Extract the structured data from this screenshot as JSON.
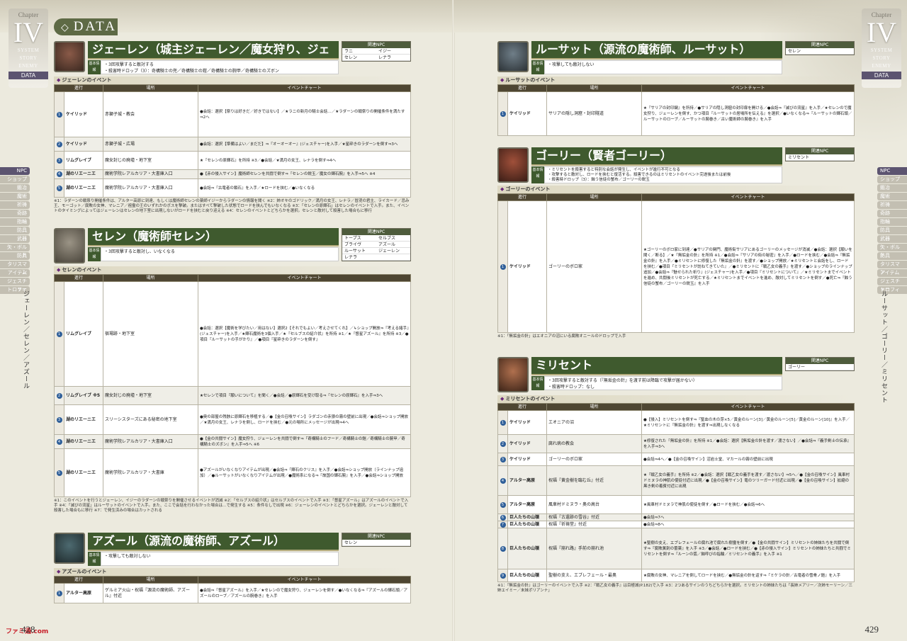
{
  "header": {
    "data_label": "DATA"
  },
  "chapter": {
    "word": "Chapter",
    "numeral": "IV",
    "menu": [
      "SYSTEM",
      "STORY",
      "ENEMY"
    ],
    "active": "DATA"
  },
  "side_tabs": [
    "NPC",
    "ショップ",
    "鍛冶",
    "魔術",
    "祈祷",
    "奇跡",
    "指輪",
    "防具",
    "武器",
    "矢・ボルト",
    "防具",
    "タリスマン",
    "アイテム",
    "ジェスチャー",
    "トロフィー"
  ],
  "left_vertical": "ジェーレン／セレン／アズール",
  "right_vertical": "ルーサット／ゴーリー／ミリセント",
  "table_headers": {
    "no": "進行",
    "place": "場所",
    "chart": "イベントチャート"
  },
  "npc_header": "関連NPC",
  "info_tag": "基本情報",
  "characters": {
    "jerren": {
      "name": "ジェーレン（城主ジェーレン／魔女狩り、ジェーレン）",
      "info": [
        "・3回攻撃すると敵対する",
        "・殺害時ドロップ（3）：奇構騎士の兜／奇構騎士の鎧／奇構騎士の腕甲／奇構騎士のズボン"
      ],
      "npcs": [
        "ラニ",
        "イジー",
        "セレン",
        "レナラ"
      ],
      "events_title": "ジェーレンのイベント",
      "rows": [
        {
          "no": "1",
          "who": "ケイリッド",
          "place": "赤獅子城・教会",
          "chart": "●会話：選択【祭りは好きだ／好きではない】／★ラニの新月の騎士会話…／★ラダーンの戦祭りの開催条件を満たす⇒2へ"
        },
        {
          "no": "2",
          "who": "ケイリッド",
          "place": "赤獅子城・広場",
          "chart": "●会話：選択【準備はよい／まだだ】⇒『オーオーオー』(ジェスチャー)を入手／★星砕きのラダーンを倒す⇒3へ"
        },
        {
          "no": "3",
          "who": "リムグレイブ",
          "place": "魔女封じの廃墟・地下室",
          "chart": "★『セレンの原輝石』を所持 ※3／●会話／★満月の女王、レナラを倒す⇒4へ"
        },
        {
          "no": "4",
          "who": "湖のリエーニエ",
          "place": "魔術学院レアルカリア・大書庫入口",
          "chart": "●【赤の侵入サイン】魔術師セレンを共闘で倒す⇒『セレンの鋭玉／魔女の輝石腕』を入手⇒5へ ※4"
        },
        {
          "no": "5",
          "who": "湖のリエーニエ",
          "place": "魔術学院レアルカリア・大書庫入口",
          "chart": "●会話⇒『古竜者の鎖石』を入手／★ロードを挟む／●いなくなる"
        }
      ],
      "note": "※1：ラダーンの戦祭り開催条件は、アルター高原に到達、もしくは魔術師セレンの薬師イジーからラダーンの情報を聞く ※2：姉オキのゴドリック／満月の女王、レナラ／冒涜の君主、ライカード／忌み王、モーゴット／腐敗の女神、マレニア／祖霊の王のいずれかのボスを撃破。またはすべて撃破した状態でロードを挟んでもいなくなる ※3：「セレンの原輝石」はセレンのイベントで入手。また、イベントのタイミングによってはジェーレンはセレンの地下室に出現しないがロードを挟むと戻り迎える ※4：セレンのイベントとどちらかを選択。セレンと敵対して殺害した場合もに移行"
    },
    "sellen": {
      "name": "セレン（魔術師セレン）",
      "info": [
        "・3回攻撃すると敵対し、いなくなる"
      ],
      "npcs": [
        "トープス",
        "セルブス",
        "ブライヴ",
        "アズール",
        "ルーサット",
        "ジェーレン",
        "レナラ",
        ""
      ],
      "events_title": "セレンのイベント",
      "rows": [
        {
          "no": "1",
          "who": "リムグレイブ",
          "place": "宿場跡・地下室",
          "chart": "●会話：選択【魔術を学びたい／用はない】選択2【それでもよい／考えさせてくれ】／↳ショップ開放⇒『考える諸手』(ジェスチャー)を入手／★輝石魔術を3個入手／★『セルブスの紹介状』を所持 ※1／★『督星アズール』を所持 ※3／●項目『ルーサットの手がかり』／●項目『星砕きのラダーンを倒す』"
        },
        {
          "no": "2",
          "who": "リムグレイブ ※5",
          "place": "魔女封じの廃墟・地下室",
          "chart": "★セレンで項目『願いについて』を聞く／●会話／●原輝石を受け取る⇒『セレンの原輝石』を入手⇒3へ"
        },
        {
          "no": "3",
          "who": "湖のリエーニエ",
          "place": "スリーシスターズにある秘密の地下室",
          "chart": "●奥の部屋の残骸に原輝石を移植する／●【金の召喚サイン】ラダゴンの赤狼の霧の壁前に出現／●会話⇒ショップ開放／★満月の女王、レナラを倒し、ロードを挟む／●元の場所にメッセージが出現⇒4へ"
        },
        {
          "no": "4",
          "who": "湖のリエーニエ",
          "place": "魔術学院レアルカリア・大書庫入口",
          "chart": "●【金の共闘サイン】魔女狩り、ジェーレンを共闘で倒す⇒『奇構騎士のフード／奇構騎士の鎧／奇構騎士の腕甲／奇構騎士のズボン』を入手⇒5へ ※6"
        },
        {
          "no": "5",
          "who": "湖のリエーニエ",
          "place": "魔術学院レアルカリア・大書庫",
          "chart": "●アズールがいなくなりアイテムが出現／●会話⇒『輝石のクリス』を入手／●会話⇒ショップ開放（ラインナップ追加）／●ルーサットがいなくなりアイテムが出現／●魔術系になる⇒『故国の輝石腕』を入手／●会話⇒ショップ開放"
        }
      ],
      "note": "※1：このイベントを行うとジェーレン、イジーのラダーンの戦祭りを開催させるイベントが消滅 ※2：「セルブスの紹介状」はセルブスのイベントで入手 ※3：「督星アズール」はアズールのイベントで入手 ※4：「滅びの流星」はルーサットのイベントで入手。また、ここで会話を行わなかった場合は…で発生する ※5：条件なしで出現 ※6：ジェーレンのイベントとどちらかを選択。ジェーレンと敵対して殺害した場合もに移行 ※7：で発生済みの場合はカットされる"
    },
    "azur": {
      "name": "アズール（源流の魔術師、アズール）",
      "info": [
        "・攻撃しても敵対しない"
      ],
      "npcs": [
        "セレン",
        ""
      ],
      "events_title": "アズールのイベント",
      "rows": [
        {
          "no": "1",
          "who": "アルター高原",
          "place": "ゲルミア火山・祝福『源流の魔術師、アズール』付近",
          "chart": "●会話⇒『督星アズール』を入手／★セレンので魔女狩り、ジェーレンを倒す／●いなくなる⇒『アズールの輝石頭／アズールのローブ／アズールの腕巻き』を入手"
        }
      ]
    },
    "rusat": {
      "name": "ルーサット（源流の魔術師、ルーサット）",
      "info": [
        "・攻撃しても敵対しない"
      ],
      "npcs": [
        "セレン",
        ""
      ],
      "events_title": "ルーサットのイベント",
      "rows": [
        {
          "no": "1",
          "who": "ケイリッド",
          "place": "サリアの隠し洞窟・封印隧道",
          "chart": "★『サリアの封印鍵』を所持／●サリアの隠し洞窟の封印扉を開ける／●会話⇒『滅びの流星』を入手／★セレンので魔女狩り、ジェーレンを倒す、かつ項目『ルーサットの居場所を伝える』を選択／●いなくなる⇒『ルーサットの輝石頭／ルーサットのローブ／ルーサットの腕巻き／古い魔術師の腕巻き』を入手"
        }
      ]
    },
    "gowry": {
      "name": "ゴーリー（賢者ゴーリー）",
      "info": [
        "・ミリセントを殺害すると特別な会話が発生し、イベントが進行不可となる",
        "・攻撃すると敵対し、ロードを挟むと復活する。殺害できるのはミリセントのイベント完遂後または前後",
        "・殺害時ドロップ（3）：蝕う信徒の蟹布／ゴーリーの鋭玉"
      ],
      "npcs": [
        "ミリセント",
        ""
      ],
      "events_title": "ゴーリーのイベント",
      "rows": [
        {
          "no": "1",
          "who": "ケイリッド",
          "place": "ゴーリーのボロ家",
          "chart": "★ゴーリーのボロ家に到達／●サリアの関門、魔術街サリアにあるゴーリーのメッセージが消滅／●会話：選択【願いを聞く／断る】／★『無垢金の針』を所持 ※1／●会話⇒『サリアの街の秘密』を入手／●ロードを挟む／●会話⇒『無垢金の針』を入手／●ミリセントに修復した『無垢金の針』を渡す／●ショップ開放／★ミリセントと会話をし、ロードを挟む／●項目『ミリセントが訪ねてきていた』／●ミリセントに『戦乙女の義手』を渡す／●ショップのラインナップ追加／●会話⇒『魅せられた祈り』(ジェスチャー)を入手／●項目『ミリセントについて』／★ミリセントまでイベントを進め、共闘後ミリセントが死亡する／★ミリセントまでイベントを進め、敵対してミリセントを倒す／●死亡⇒『蝕う信徒の蟹布／ゴーリーの鋭玉』を入手"
        }
      ],
      "note": "※1：「無垢金の針」はエオニアの沼にいる腐敗オニールのドロップで入手"
    },
    "millicent": {
      "name": "ミリセント",
      "info": [
        "・3回攻撃すると敵対する（『無垢金の針』を渡す前は降臨で攻撃が届かない）",
        "・殺害時ドロップ：なし"
      ],
      "npcs": [
        "ゴーリー",
        ""
      ],
      "events_title": "ミリセントのイベント",
      "rows": [
        {
          "no": "1",
          "who": "ケイリッド",
          "place": "エオニアの沼",
          "chart": "●【侵入】ミリセントを倒す⇒『聖血の木の芽×5／黄金のルーン[3]／黄金のルーン[5]／黄金のルーン[10]』を入手／★ミリセントに『無垢金の針』を渡す⇒出現しなくなる"
        },
        {
          "no": "2",
          "who": "ケイリッド",
          "place": "腐れ病の教会",
          "chart": "★修復された『無垢金の針』を所持 ※1／●会話：選択【無垢金の針を渡す／渡さない】／●会話⇒『義手剣士の伝承』を入手⇒3へ"
        },
        {
          "no": "3",
          "who": "ケイリッド",
          "place": "ゴーリーのボロ家",
          "chart": "●会話⇒4へ／●【金の召喚サイン】沼岩士堂、マカールの霧の壁前に出現"
        },
        {
          "no": "4",
          "who": "アルター高原",
          "place": "祝福『黄金樹を臨む丘』付近",
          "chart": "★『戦乙女の義手』を所持 ※2／●会話：選択【戦乙女の義手を渡す／渡さない】⇒5へ／●【金の召喚サイン】風車村ドミヌラの神肌の使徒付近に出現／●【金の召喚サイン】竜のツリーガード付近に出現／●【金の召喚サイン】拡縮の黒き剣の着賓付近に出現"
        },
        {
          "no": "5",
          "who": "アルター高原",
          "place": "風車村ドミヌラ・奥の高台",
          "chart": "★風車村ドミヌラで神肌の使徒を倒す／●ロードを挟む／●会話⇒6へ"
        },
        {
          "no": "6",
          "who": "巨人たちの山嶺",
          "place": "祝福『古遺跡の雪谷』付近",
          "chart": "●会話⇒7へ"
        },
        {
          "no": "7",
          "who": "巨人たちの山嶺",
          "place": "祝福『祈祷堂』付近",
          "chart": "●会話⇒8へ"
        },
        {
          "no": "8",
          "who": "巨人たちの山嶺",
          "place": "祝福『崩れ路』手前の崩れ池",
          "chart": "★聖樹の支え、エブレフェールの腐れ池で腐れた樹霊を倒す／●【金の共闘サイン】ミリセントの姉妹たちを共闘で倒す⇒『腐敗薫剤の蕾薬』を入手 ※3／●会話／●ロードを挟む／●【赤の侵入サイン】ミリセントの姉妹たちと共闘でミリセントを倒す⇒『ルーンの弧／蝕呼びの指輪／ミリセントの義手』を入手 ※1"
        },
        {
          "no": "9",
          "who": "巨人たちの山嶺",
          "place": "聖樹の支え、エブレフェール・最奥",
          "chart": "★腐敗の女神、マレニアを倒してロードを挟む／●無垢金の針を返す⇒『ミケラの針／古竜者の雪骨ノ鎧』を入手"
        }
      ],
      "note": "※1：『無垢金の針』はゴーリーのイベントで入手 ※2：『戦乙女の義手』は目極城(P.182)で入手 ※3：2つあるサインのうちどちらかを選択。ミリセントの姉妹たちは「長姉メアリー／次姉モーリーン／三姉エイミー／末妹ポリアンナ」"
    }
  },
  "pages": {
    "left": "428",
    "right": "429"
  },
  "logo": "ファミ通.com"
}
